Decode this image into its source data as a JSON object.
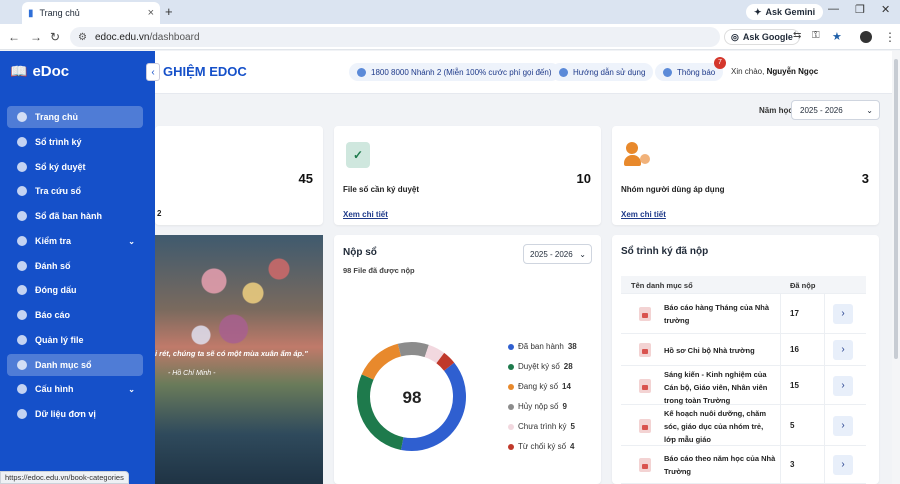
{
  "browser": {
    "tab_title": "Trang chủ",
    "new_tab": "+",
    "gemini_label": "Ask Gemini",
    "url_host": "edoc.edu.vn",
    "url_path": "/dashboard",
    "ask_google": "Ask Google",
    "status_url": "https://edoc.edu.vn/book-categories"
  },
  "sidebar": {
    "brand": "eDoc",
    "items": [
      {
        "label": "Trang chủ",
        "active": true
      },
      {
        "label": "Sổ trình ký"
      },
      {
        "label": "Sổ ký duyệt"
      },
      {
        "label": "Tra cứu sổ"
      },
      {
        "label": "Sổ đã ban hành"
      },
      {
        "label": "Kiểm tra",
        "expand": true
      },
      {
        "label": "Đánh số"
      },
      {
        "label": "Đóng dấu"
      },
      {
        "label": "Báo cáo"
      },
      {
        "label": "Quản lý file"
      },
      {
        "label": "Danh mục sổ",
        "active": true
      },
      {
        "label": "Cấu hình",
        "expand": true
      },
      {
        "label": "Dữ liệu đơn vị"
      }
    ]
  },
  "header": {
    "title": "GHIỆM EDOC",
    "hotline": "1800 8000 Nhánh 2 (Miễn 100% cước phí gọi đến)",
    "guide": "Hướng dẫn sử dụng",
    "notify": "Thông báo",
    "notify_count": "7",
    "greeting": "Xin chào,",
    "user": "Nguyễn Ngọc"
  },
  "filter": {
    "label": "Năm học",
    "value": "2025 - 2026"
  },
  "cards": [
    {
      "count": "45",
      "sub": "2"
    },
    {
      "count": "10",
      "label": "File số cần ký duyệt",
      "link": "Xem chi tiết"
    },
    {
      "count": "3",
      "label": "Nhóm người dùng áp dụng",
      "link": "Xem chi tiết"
    }
  ],
  "quote": {
    "text": "i rét, chúng ta sẽ có một mùa xuân ấm áp.\"",
    "author": "- Hồ Chí Minh -"
  },
  "nop_so": {
    "title": "Nộp sổ",
    "subtitle": "98 File đã được nộp",
    "year": "2025 - 2026",
    "total": "98"
  },
  "chart_data": {
    "type": "pie",
    "categories": [
      "Đã ban hành",
      "Duyệt ký số",
      "Đang ký số",
      "Hủy nộp số",
      "Chưa trình ký",
      "Từ chối ký số"
    ],
    "values": [
      38,
      28,
      14,
      9,
      5,
      4
    ],
    "colors": [
      "#2f5fd0",
      "#1e7a4c",
      "#e8892c",
      "#8c8c8c",
      "#f2d8df",
      "#c0392b"
    ],
    "title": "Nộp sổ",
    "legend": "right"
  },
  "table": {
    "title": "Sổ trình ký đã nộp",
    "col_name": "Tên danh mục sổ",
    "col_count": "Đã nộp",
    "go": "›",
    "rows": [
      {
        "name": "Báo cáo hàng Tháng của Nhà trường",
        "count": "17"
      },
      {
        "name": "Hồ sơ Chi bộ Nhà trường",
        "count": "16"
      },
      {
        "name": "Sáng kiến - Kinh nghiệm của Cán bộ, Giáo viên, Nhân viên trong toàn Trường",
        "count": "15"
      },
      {
        "name": "Kế hoạch nuôi dưỡng, chăm sóc, giáo dục của nhóm trẻ, lớp mẫu giáo",
        "count": "5"
      },
      {
        "name": "Báo cáo theo năm học của Nhà Trường",
        "count": "3"
      }
    ]
  }
}
